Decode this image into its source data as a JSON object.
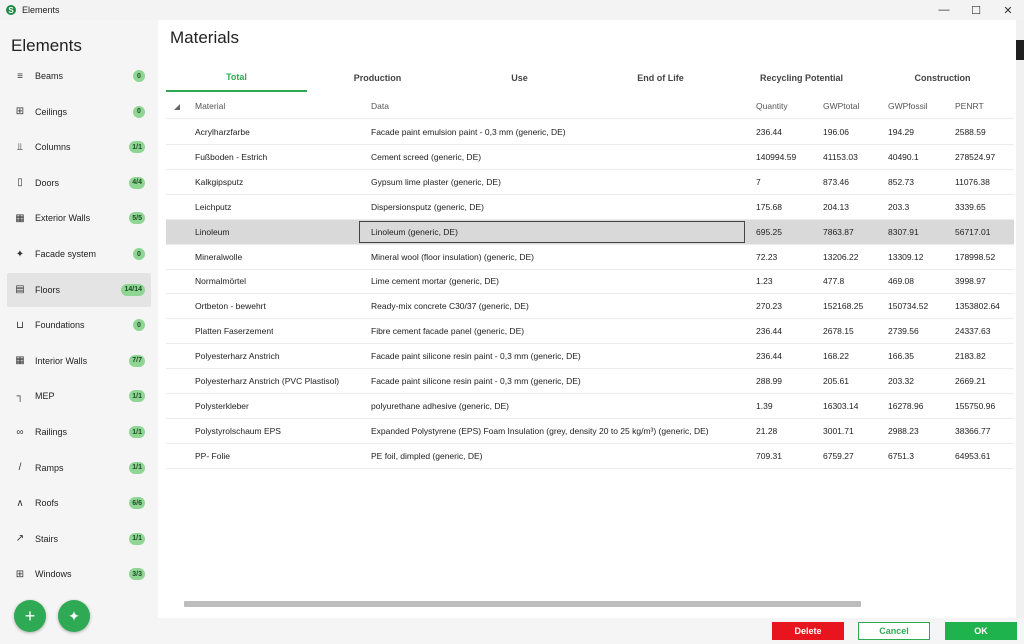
{
  "window": {
    "title": "Elements"
  },
  "sidebar": {
    "title": "Elements",
    "items": [
      {
        "label": "Beams",
        "badge": "0",
        "icon": "beam-icon"
      },
      {
        "label": "Ceilings",
        "badge": "0",
        "icon": "ceiling-icon"
      },
      {
        "label": "Columns",
        "badge": "1/1",
        "icon": "column-icon"
      },
      {
        "label": "Doors",
        "badge": "4/4",
        "icon": "door-icon"
      },
      {
        "label": "Exterior Walls",
        "badge": "5/5",
        "icon": "exterior-wall-icon"
      },
      {
        "label": "Facade system",
        "badge": "0",
        "icon": "facade-icon"
      },
      {
        "label": "Floors",
        "badge": "14/14",
        "icon": "floor-icon"
      },
      {
        "label": "Foundations",
        "badge": "0",
        "icon": "foundation-icon"
      },
      {
        "label": "Interior Walls",
        "badge": "7/7",
        "icon": "interior-wall-icon"
      },
      {
        "label": "MEP",
        "badge": "1/1",
        "icon": "mep-icon"
      },
      {
        "label": "Railings",
        "badge": "1/1",
        "icon": "railing-icon"
      },
      {
        "label": "Ramps",
        "badge": "1/1",
        "icon": "ramp-icon"
      },
      {
        "label": "Roofs",
        "badge": "6/6",
        "icon": "roof-icon"
      },
      {
        "label": "Stairs",
        "badge": "1/1",
        "icon": "stairs-icon"
      },
      {
        "label": "Windows",
        "badge": "3/3",
        "icon": "window-icon"
      }
    ],
    "active": "Floors"
  },
  "main": {
    "title": "Materials",
    "tabs": [
      "Total",
      "Production",
      "Use",
      "End of Life",
      "Recycling Potential",
      "Construction"
    ],
    "active_tab": "Total",
    "columns": [
      "Material",
      "Data",
      "Quantity",
      "GWPtotal",
      "GWPfossil",
      "PENRT"
    ],
    "rows": [
      [
        "Acrylharzfarbe",
        "Facade paint emulsion paint -  0,3 mm (generic, DE)",
        "236.44",
        "196.06",
        "194.29",
        "2588.59"
      ],
      [
        "Fußboden - Estrich",
        "Cement screed (generic, DE)",
        "140994.59",
        "41153.03",
        "40490.1",
        "278524.97"
      ],
      [
        "Kalkgipsputz",
        "Gypsum lime plaster (generic, DE)",
        "7",
        "873.46",
        "852.73",
        "11076.38"
      ],
      [
        "Leichputz",
        "Dispersionsputz (generic, DE)",
        "175.68",
        "204.13",
        "203.3",
        "3339.65"
      ],
      [
        "Linoleum",
        "Linoleum (generic, DE)",
        "695.25",
        "7863.87",
        "8307.91",
        "56717.01"
      ],
      [
        "Mineralwolle",
        "Mineral wool (floor insulation) (generic, DE)",
        "72.23",
        "13206.22",
        "13309.12",
        "178998.52"
      ],
      [
        "Normalmörtel",
        "Lime cement mortar (generic, DE)",
        "1.23",
        "477.8",
        "469.08",
        "3998.97"
      ],
      [
        "Ortbeton - bewehrt",
        "Ready-mix concrete C30/37 (generic, DE)",
        "270.23",
        "152168.25",
        "150734.52",
        "1353802.64"
      ],
      [
        "Platten Faserzement",
        "Fibre cement facade panel (generic, DE)",
        "236.44",
        "2678.15",
        "2739.56",
        "24337.63"
      ],
      [
        "Polyesterharz Anstrich",
        "Facade paint silicone resin paint -  0,3 mm (generic, DE)",
        "236.44",
        "168.22",
        "166.35",
        "2183.82"
      ],
      [
        "Polyesterharz Anstrich (PVC Plastisol)",
        "Facade paint silicone resin paint -  0,3 mm (generic, DE)",
        "288.99",
        "205.61",
        "203.32",
        "2669.21"
      ],
      [
        "Polysterkleber",
        "polyurethane adhesive (generic, DE)",
        "1.39",
        "16303.14",
        "16278.96",
        "155750.96"
      ],
      [
        "Polystyrolschaum EPS",
        "Expanded Polystyrene (EPS) Foam Insulation (grey, density 20 to 25 kg/m³) (generic, DE)",
        "21.28",
        "3001.71",
        "2988.23",
        "38366.77"
      ],
      [
        "PP- Folie",
        "PE foil, dimpled (generic, DE)",
        "709.31",
        "6759.27",
        "6751.3",
        "64953.61"
      ]
    ],
    "selected_row": 4
  },
  "footer": {
    "delete": "Delete",
    "cancel": "Cancel",
    "ok": "OK"
  },
  "colors": {
    "accent": "#2eaa55",
    "danger": "#e8141e",
    "badge": "#8fd694"
  }
}
